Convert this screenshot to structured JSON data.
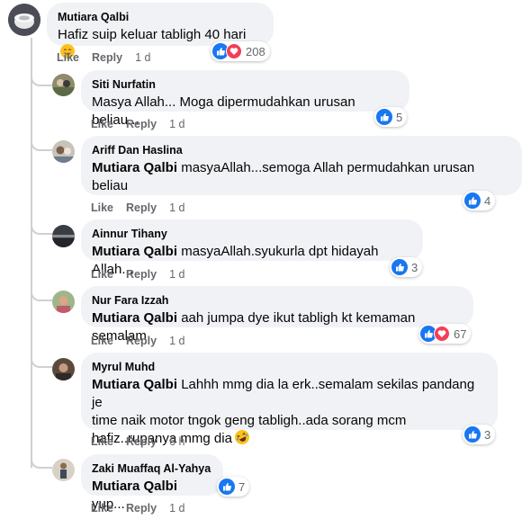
{
  "comments": [
    {
      "author": "Mutiara Qalbi",
      "mention": "",
      "text": "Hafiz suip keluar tabligh 40 hari",
      "emoji": "relieved-face",
      "like": "Like",
      "reply": "Reply",
      "time": "1 d",
      "reactions": [
        "like",
        "love"
      ],
      "reaction_count": "208"
    },
    {
      "author": "Siti Nurfatin",
      "mention": "",
      "text": "Masya Allah... Moga dipermudahkan urusan beliau...",
      "like": "Like",
      "reply": "Reply",
      "time": "1 d",
      "reactions": [
        "like"
      ],
      "reaction_count": "5"
    },
    {
      "author": "Ariff Dan Haslina",
      "mention": "Mutiara Qalbi",
      "text": "masyaAllah...semoga Allah permudahkan urusan",
      "text2": "beliau",
      "like": "Like",
      "reply": "Reply",
      "time": "1 d",
      "reactions": [
        "like"
      ],
      "reaction_count": "4"
    },
    {
      "author": "Ainnur Tihany",
      "mention": "Mutiara Qalbi",
      "text": "masyaAllah.syukurla dpt hidayah Allah...",
      "like": "Like",
      "reply": "Reply",
      "time": "1 d",
      "reactions": [
        "like"
      ],
      "reaction_count": "3"
    },
    {
      "author": "Nur Fara Izzah",
      "mention": "Mutiara Qalbi",
      "text": "aah jumpa dye ikut tabligh kt kemaman semalam",
      "like": "Like",
      "reply": "Reply",
      "time": "1 d",
      "reactions": [
        "like",
        "love"
      ],
      "reaction_count": "67"
    },
    {
      "author": "Myrul Muhd",
      "mention": "Mutiara Qalbi",
      "text": "Lahhh mmg dia la erk..semalam sekilas pandang je",
      "text2": "time naik motor tngok geng tabligh..ada sorang mcm",
      "text3": "hafiz..rupanya mmg dia",
      "emoji": "rofl-face",
      "like": "Like",
      "reply": "Reply",
      "time": "6 h",
      "reactions": [
        "like"
      ],
      "reaction_count": "3"
    },
    {
      "author": "Zaki Muaffaq Al-Yahya",
      "mention": "Mutiara Qalbi",
      "text": "yup...",
      "like": "Like",
      "reply": "Reply",
      "time": "1 d",
      "reactions": [
        "like"
      ],
      "reaction_count": "7"
    }
  ],
  "colors": {
    "bubble": "#f0f2f5",
    "like": "#1877f2",
    "love": "#f33e58",
    "meta": "#65676b"
  }
}
